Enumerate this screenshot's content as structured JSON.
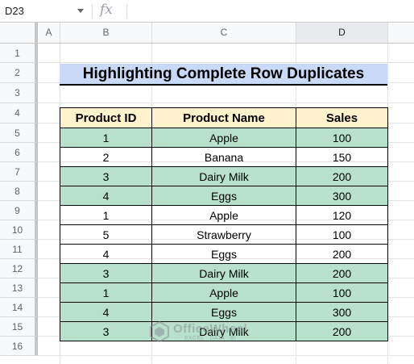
{
  "formula_bar": {
    "cell_ref": "D23",
    "fx_label": "fx",
    "formula": ""
  },
  "columns": [
    "A",
    "B",
    "C",
    "D"
  ],
  "selected_column": "D",
  "rows": [
    "1",
    "2",
    "3",
    "4",
    "5",
    "6",
    "7",
    "8",
    "9",
    "10",
    "11",
    "12",
    "13",
    "14",
    "15",
    "16"
  ],
  "title": "Highlighting Complete Row Duplicates",
  "table": {
    "headers": [
      "Product ID",
      "Product Name",
      "Sales"
    ],
    "rows": [
      {
        "id": "1",
        "name": "Apple",
        "sales": "100",
        "highlight": true
      },
      {
        "id": "2",
        "name": "Banana",
        "sales": "150",
        "highlight": false
      },
      {
        "id": "3",
        "name": "Dairy Milk",
        "sales": "200",
        "highlight": true
      },
      {
        "id": "4",
        "name": "Eggs",
        "sales": "300",
        "highlight": true
      },
      {
        "id": "1",
        "name": "Apple",
        "sales": "120",
        "highlight": false
      },
      {
        "id": "5",
        "name": "Strawberry",
        "sales": "100",
        "highlight": false
      },
      {
        "id": "4",
        "name": "Eggs",
        "sales": "200",
        "highlight": false
      },
      {
        "id": "3",
        "name": "Dairy Milk",
        "sales": "200",
        "highlight": true
      },
      {
        "id": "1",
        "name": "Apple",
        "sales": "100",
        "highlight": true
      },
      {
        "id": "4",
        "name": "Eggs",
        "sales": "300",
        "highlight": true
      },
      {
        "id": "3",
        "name": "Dairy Milk",
        "sales": "200",
        "highlight": true
      }
    ]
  },
  "colors": {
    "title_bg": "#c9daf8",
    "header_bg": "#fff2cc",
    "duplicate_bg": "#b7e1cd"
  },
  "watermark": {
    "name": "OfficeWheel",
    "tagline": "EXCEL · DATA · BI"
  }
}
